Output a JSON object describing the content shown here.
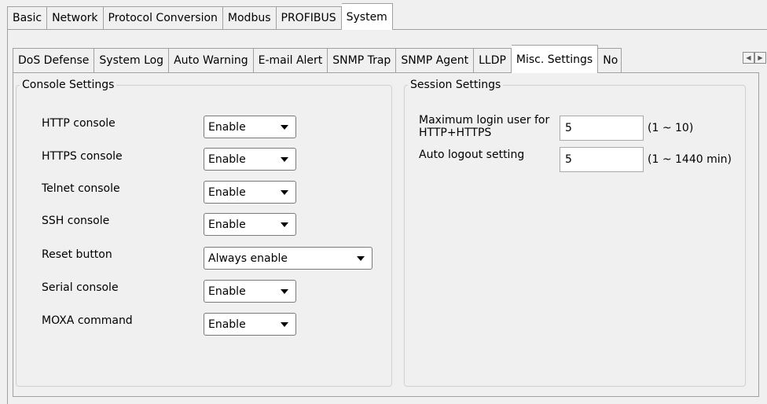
{
  "outer_tabs": [
    "Basic",
    "Network",
    "Protocol Conversion",
    "Modbus",
    "PROFIBUS",
    "System"
  ],
  "inner_tabs": [
    "DoS Defense",
    "System Log",
    "Auto Warning",
    "E-mail Alert",
    "SNMP Trap",
    "SNMP Agent",
    "LLDP",
    "Misc. Settings",
    "No"
  ],
  "console": {
    "title": "Console Settings",
    "rows": [
      {
        "label": "HTTP console",
        "value": "Enable"
      },
      {
        "label": "HTTPS console",
        "value": "Enable"
      },
      {
        "label": "Telnet console",
        "value": "Enable"
      },
      {
        "label": "SSH console",
        "value": "Enable"
      },
      {
        "label": "Reset button",
        "value": "Always enable"
      },
      {
        "label": "Serial console",
        "value": "Enable"
      },
      {
        "label": "MOXA command",
        "value": "Enable"
      }
    ]
  },
  "session": {
    "title": "Session Settings",
    "max_login_label_1": "Maximum login user for",
    "max_login_label_2": "HTTP+HTTPS",
    "max_login_value": "5",
    "max_login_range": "(1 ~ 10)",
    "auto_logout_label": "Auto logout setting",
    "auto_logout_value": "5",
    "auto_logout_range": "(1 ~ 1440 min)"
  }
}
